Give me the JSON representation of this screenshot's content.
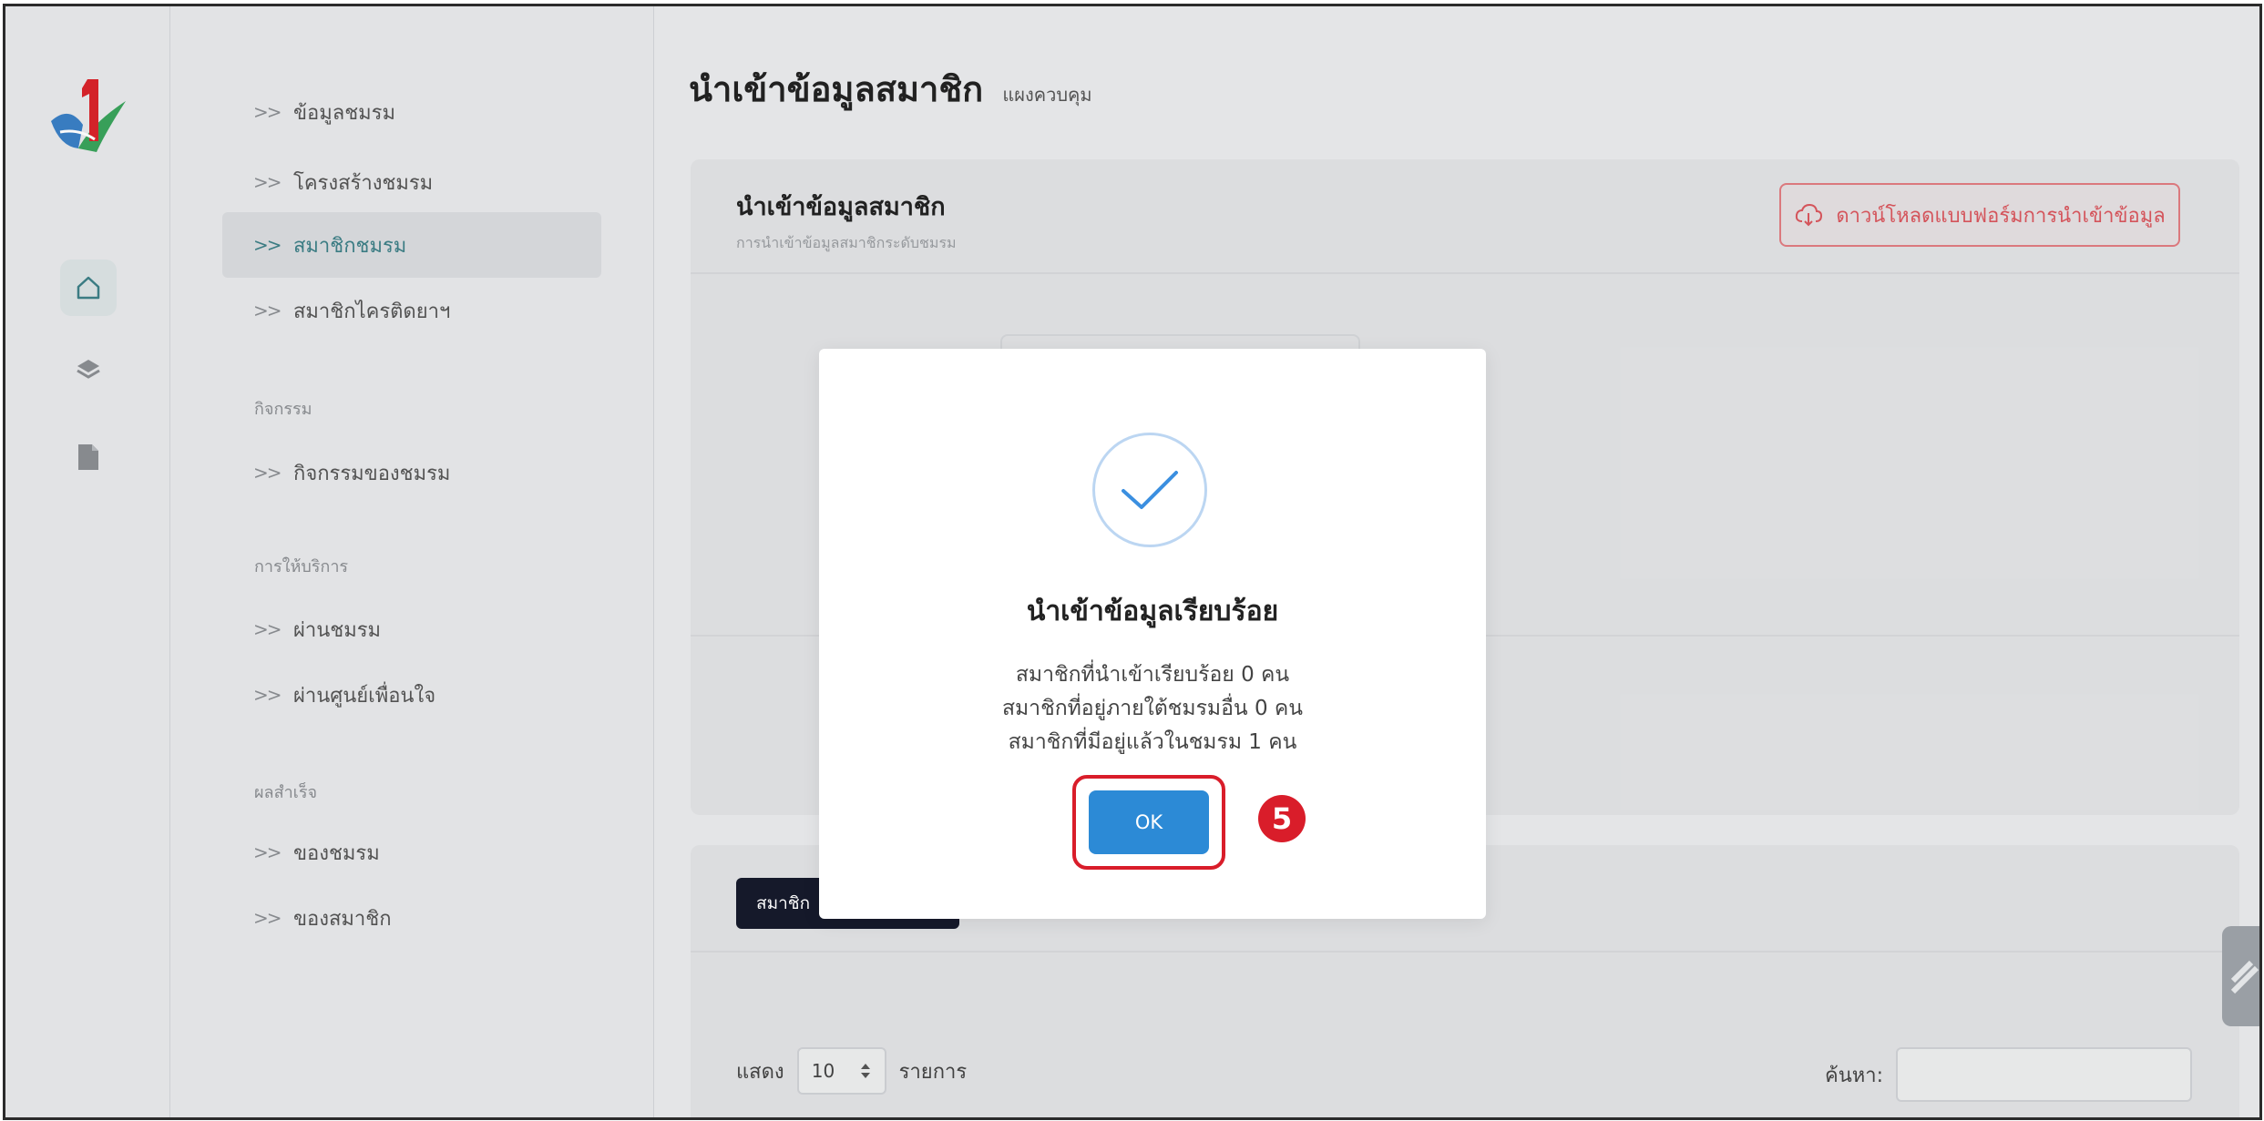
{
  "menu": {
    "items": [
      {
        "label": "ข้อมูลชมรม",
        "chevron": ">>"
      },
      {
        "label": "โครงสร้างชมรม",
        "chevron": ">>"
      },
      {
        "label": "สมาชิกชมรม",
        "chevron": ">>",
        "active": true
      },
      {
        "label": "สมาชิกไครติดยาฯ",
        "chevron": ">>"
      }
    ],
    "sections": [
      {
        "title": "กิจกรรม",
        "items": [
          {
            "label": "กิจกรรมของชมรม",
            "chevron": ">>"
          }
        ]
      },
      {
        "title": "การให้บริการ",
        "items": [
          {
            "label": "ผ่านชมรม",
            "chevron": ">>"
          },
          {
            "label": "ผ่านศูนย์เพื่อนใจ",
            "chevron": ">>"
          }
        ]
      },
      {
        "title": "ผลสำเร็จ",
        "items": [
          {
            "label": "ของชมรม",
            "chevron": ">>"
          },
          {
            "label": "ของสมาชิก",
            "chevron": ">>"
          }
        ]
      }
    ]
  },
  "rail": {
    "icons": [
      "home-icon",
      "layers-icon",
      "document-icon"
    ],
    "active": "home-icon"
  },
  "header": {
    "title": "นำเข้าข้อมูลสมาชิก",
    "breadcrumb": "แผงควบคุม"
  },
  "card": {
    "title": "นำเข้าข้อมูลสมาชิก",
    "subtitle": "การนำเข้าข้อมูลสมาชิกระดับชมรม",
    "download_button": "ดาวน์โหลดแบบฟอร์มการนำเข้าข้อมูล"
  },
  "table": {
    "tab_label": "สมาชิก",
    "show_label": "แสดง",
    "page_size": "10",
    "page_size_suffix": "รายการ",
    "search_label": "ค้นหา:"
  },
  "modal": {
    "title": "นำเข้าข้อมูลเรียบร้อย",
    "lines": [
      "สมาชิกที่นำเข้าเรียบร้อย 0 คน",
      "สมาชิกที่อยู่ภายใต้ชมรมอื่น 0 คน",
      "สมาชิกที่มีอยู่แล้วในชมรม 1 คน"
    ],
    "ok_label": "OK",
    "step_number": "5"
  },
  "colors": {
    "accent": "#3d7f86",
    "ok_button": "#2c8ad6",
    "highlight": "#d91d2a",
    "download": "#d9565d"
  }
}
